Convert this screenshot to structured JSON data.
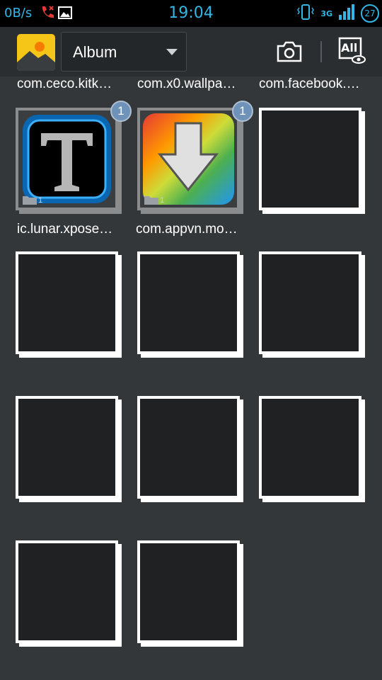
{
  "status_bar": {
    "net_speed": "0B/s",
    "time": "19:04",
    "network": "3G",
    "battery": "27"
  },
  "action_bar": {
    "spinner_label": "Album",
    "all_label": "All"
  },
  "top_partial_labels": [
    "com.ceco.kitk…",
    "com.x0.wallpa…",
    "com.facebook.…"
  ],
  "albums": [
    {
      "label": "ic.lunar.xpose…",
      "badge": "1",
      "count": "1"
    },
    {
      "label": "com.appvn.mo…",
      "badge": "1",
      "count": "1"
    }
  ]
}
